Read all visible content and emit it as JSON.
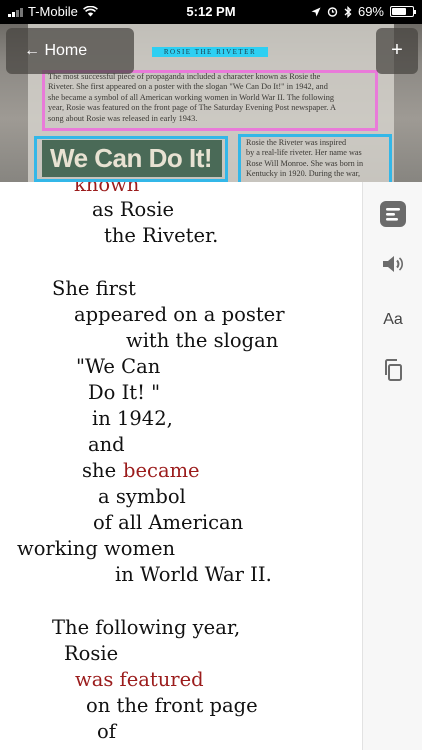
{
  "status_bar": {
    "carrier": "T-Mobile",
    "time": "5:12 PM",
    "battery": "69%",
    "battery_level": 0.69
  },
  "nav": {
    "back_label": "← Home",
    "add_label": "+"
  },
  "scan": {
    "page_title": "ROSIE THE RIVETER",
    "paragraph_lines": [
      "The most successful piece of propaganda included a character known as Rosie the",
      "Riveter. She first appeared on a poster with the slogan \"We Can Do It!\" in 1942, and",
      "she became a symbol of all American working women in World War II. The following",
      "year, Rosie was featured on the front page of The Saturday Evening Post newspaper. A",
      "song about Rosie was released in early 1943."
    ],
    "poster_text": "We Can Do It!",
    "side_lines": [
      "Rosie the Riveter was inspired",
      "by a real-life riveter. Her name was",
      "Rose Will Monroe. She was born in",
      "Kentucky in 1920. During the war,"
    ]
  },
  "reader": {
    "lines": [
      {
        "text": "known",
        "highlight": true
      },
      {
        "text": "as Rosie",
        "highlight": false
      },
      {
        "text": "the Riveter.",
        "highlight": false
      },
      {
        "text": "She first",
        "highlight": false
      },
      {
        "text": "appeared on a poster",
        "highlight": false
      },
      {
        "text": "with the slogan",
        "highlight": false
      },
      {
        "text": "\"We Can",
        "highlight": false
      },
      {
        "text": "Do It! \"",
        "highlight": false
      },
      {
        "text": "in 1942,",
        "highlight": false
      },
      {
        "text": "and",
        "highlight": false
      },
      {
        "text": "she",
        "highlight": false
      },
      {
        "text": "became",
        "highlight": true
      },
      {
        "text": "a symbol",
        "highlight": false
      },
      {
        "text": "of all American",
        "highlight": false
      },
      {
        "text": "working women",
        "highlight": false
      },
      {
        "text": "in World War II.",
        "highlight": false
      },
      {
        "text": "The following year,",
        "highlight": false
      },
      {
        "text": "Rosie",
        "highlight": false
      },
      {
        "text": "was featured",
        "highlight": true
      },
      {
        "text": "on the front page",
        "highlight": false
      },
      {
        "text": "of",
        "highlight": false
      }
    ]
  },
  "toolbar": {
    "font_label": "Aa",
    "tools": [
      "document-icon",
      "speaker-icon",
      "font-size-icon",
      "copy-icon"
    ]
  },
  "colors": {
    "highlight_text": "#9b1c1c",
    "pink_box": "#e97ad9",
    "blue_box": "#33b7e8"
  }
}
